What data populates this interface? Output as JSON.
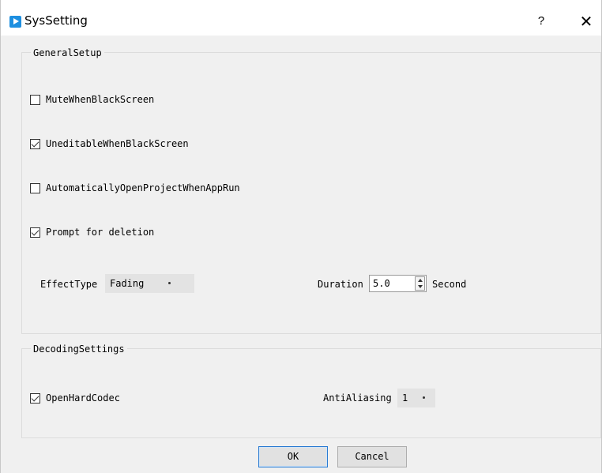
{
  "window": {
    "title": "SysSetting",
    "help_label": "?",
    "close_label": "✕"
  },
  "general": {
    "title": "GeneralSetup",
    "options": [
      {
        "label": "MuteWhenBlackScreen",
        "checked": false
      },
      {
        "label": "UneditableWhenBlackScreen",
        "checked": true
      },
      {
        "label": "AutomaticallyOpenProjectWhenAppRun",
        "checked": false
      },
      {
        "label": "Prompt for deletion",
        "checked": true
      }
    ],
    "effect_type_label": "EffectType",
    "effect_type_value": "Fading",
    "duration_label": "Duration",
    "duration_value": "5.0",
    "duration_unit": "Second"
  },
  "decoding": {
    "title": "DecodingSettings",
    "open_hard_codec_label": "OpenHardCodec",
    "open_hard_codec_checked": true,
    "anti_aliasing_label": "AntiAliasing",
    "anti_aliasing_value": "1"
  },
  "buttons": {
    "ok": "OK",
    "cancel": "Cancel"
  }
}
